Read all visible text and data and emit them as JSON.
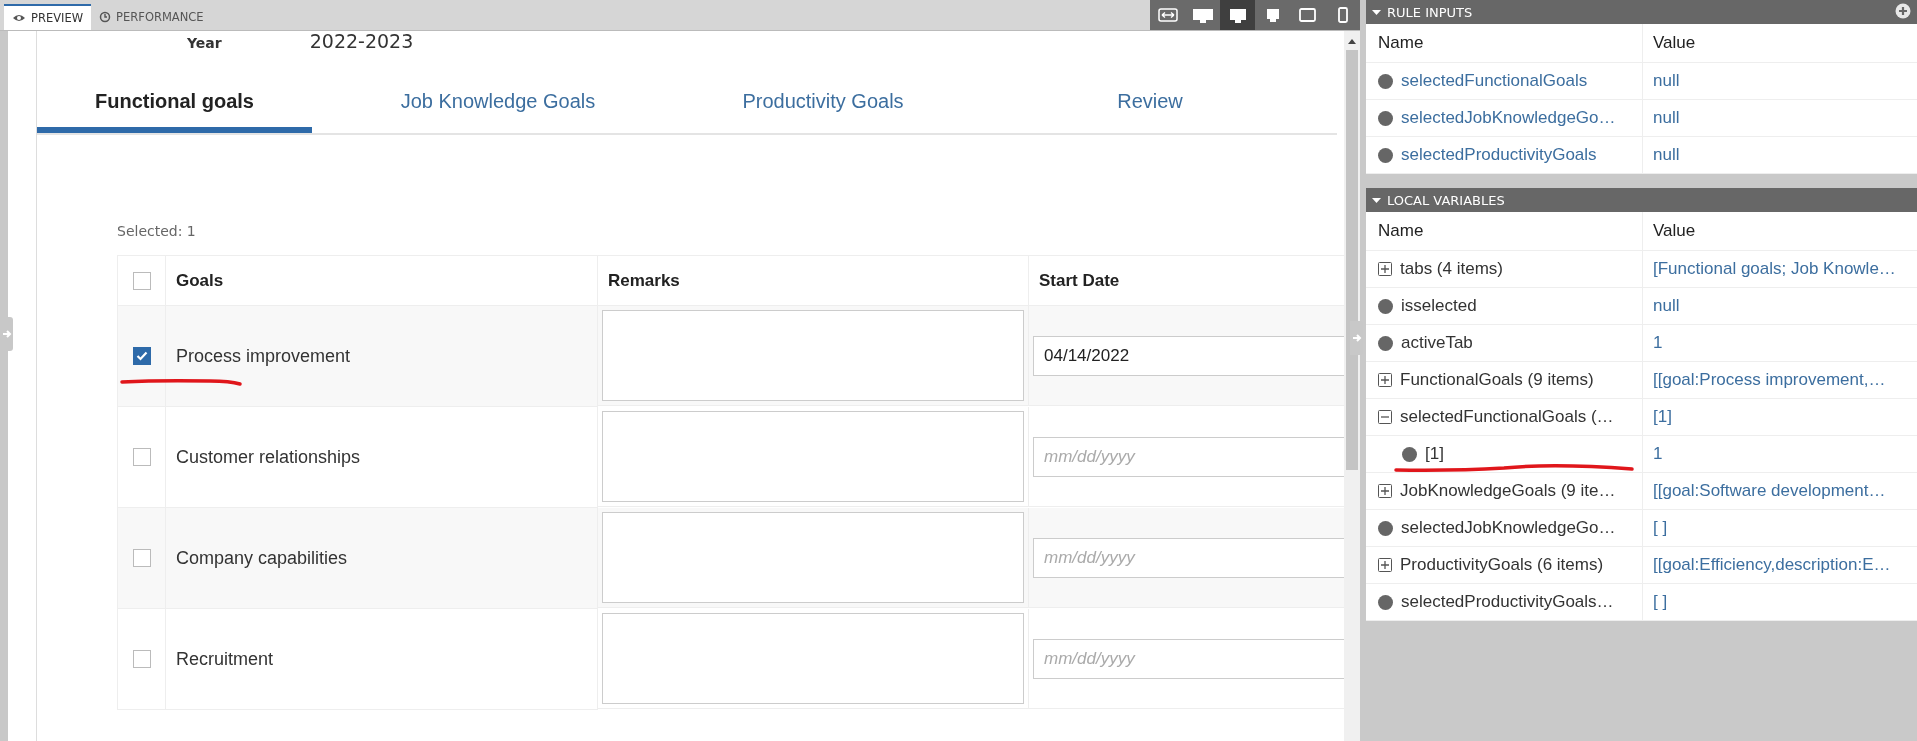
{
  "preview_tabs": [
    {
      "label": "PREVIEW",
      "selected": true,
      "kind": "eye"
    },
    {
      "label": "PERFORMANCE",
      "selected": false,
      "kind": "gauge"
    }
  ],
  "device_buttons": [
    {
      "kind": "fit",
      "selected": false
    },
    {
      "kind": "wide",
      "selected": false
    },
    {
      "kind": "desktop",
      "selected": true
    },
    {
      "kind": "monitor",
      "selected": false
    },
    {
      "kind": "tablet",
      "selected": false
    },
    {
      "kind": "phone",
      "selected": false
    }
  ],
  "form": {
    "year_label": "Year",
    "year_value": "2022-2023",
    "tabs": [
      {
        "label": "Functional goals",
        "selected": true
      },
      {
        "label": "Job Knowledge Goals",
        "selected": false
      },
      {
        "label": "Productivity Goals",
        "selected": false
      },
      {
        "label": "Review",
        "selected": false
      }
    ],
    "selected_count": "Selected: 1",
    "table": {
      "columns": [
        "Goals",
        "Remarks",
        "Start Date"
      ],
      "all_checked": false,
      "rows": [
        {
          "checked": true,
          "goal": "Process improvement",
          "start_date": "04/14/2022",
          "underlined": true
        },
        {
          "checked": false,
          "goal": "Customer relationships",
          "placeholder": "mm/dd/yyyy"
        },
        {
          "checked": false,
          "goal": "Company capabilities",
          "placeholder": "mm/dd/yyyy"
        },
        {
          "checked": false,
          "goal": "Recruitment",
          "placeholder": "mm/dd/yyyy"
        }
      ]
    }
  },
  "rule_inputs": {
    "title": "RULE INPUTS",
    "columns": [
      "Name",
      "Value"
    ],
    "rows": [
      {
        "kind": "leaf",
        "name": "selectedFunctionalGoals",
        "value": "null"
      },
      {
        "kind": "leaf",
        "name": "selectedJobKnowledgeGo…",
        "value": "null"
      },
      {
        "kind": "leaf",
        "name": "selectedProductivityGoals",
        "value": "null"
      }
    ]
  },
  "local_variables": {
    "title": "LOCAL VARIABLES",
    "columns": [
      "Name",
      "Value"
    ],
    "rows": [
      {
        "kind": "list",
        "expanded": false,
        "name": "tabs (4 items)",
        "value": "[Functional goals; Job Knowle…"
      },
      {
        "kind": "leaf",
        "name": "isselected",
        "value": "null"
      },
      {
        "kind": "leaf",
        "name": "activeTab",
        "value": "1"
      },
      {
        "kind": "list",
        "expanded": false,
        "name": "FunctionalGoals (9 items)",
        "value": "[[goal:Process improvement,…"
      },
      {
        "kind": "list",
        "expanded": true,
        "name": "selectedFunctionalGoals (…",
        "value": "[1]",
        "children": [
          {
            "kind": "leaf",
            "name": "[1]",
            "value": "1",
            "underlined": true
          }
        ]
      },
      {
        "kind": "list",
        "expanded": false,
        "name": "JobKnowledgeGoals (9 ite…",
        "value": "[[goal:Software development…"
      },
      {
        "kind": "leaf",
        "name": "selectedJobKnowledgeGo…",
        "value": "[ ]"
      },
      {
        "kind": "list",
        "expanded": false,
        "name": "ProductivityGoals (6 items)",
        "value": "[[goal:Efficiency,description:E…"
      },
      {
        "kind": "leaf",
        "name": "selectedProductivityGoals…",
        "value": "[ ]"
      }
    ]
  }
}
